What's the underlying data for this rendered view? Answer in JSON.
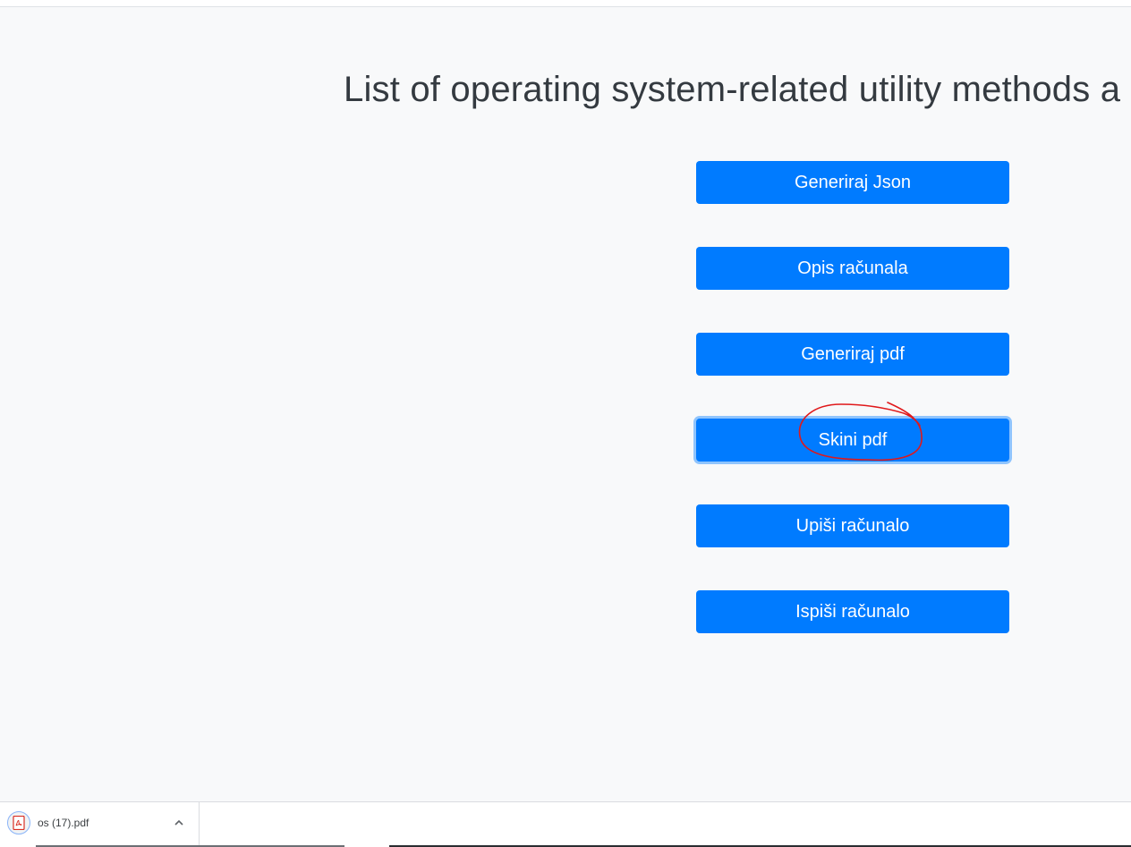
{
  "page": {
    "title": "List of operating system-related utility methods a"
  },
  "buttons": [
    {
      "label": "Generiraj Json"
    },
    {
      "label": "Opis računala"
    },
    {
      "label": "Generiraj pdf"
    },
    {
      "label": "Skini pdf"
    },
    {
      "label": "Upiši računalo"
    },
    {
      "label": "Ispiši računalo"
    }
  ],
  "download_bar": {
    "file_name": "os (17).pdf",
    "file_icon": "pdf-file-icon",
    "menu_icon": "chevron-up-icon"
  },
  "colors": {
    "primary": "#007bff",
    "annotation": "#e0191b",
    "background": "#f8f9fa",
    "title_text": "#343a40"
  }
}
